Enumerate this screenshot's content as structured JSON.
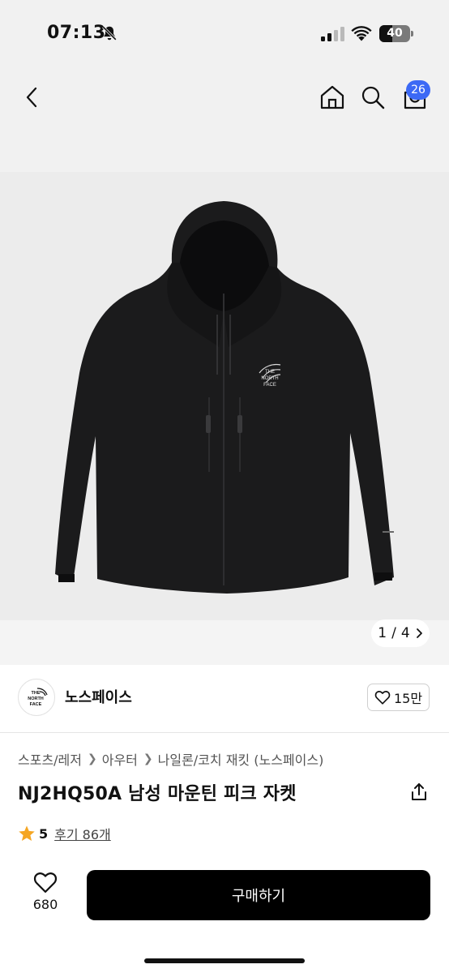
{
  "status_bar": {
    "time": "07:13",
    "battery": "40",
    "icons": [
      "bell-off-icon",
      "signal-icon",
      "wifi-icon",
      "battery-icon"
    ]
  },
  "nav": {
    "icons": [
      "chevron-left-icon",
      "home-icon",
      "search-icon",
      "cart-icon"
    ],
    "cart_badge": "26"
  },
  "product_image": {
    "logo_text": [
      "THE",
      "NORTH",
      "FACE"
    ],
    "counter_current": "1",
    "counter_sep": "/",
    "counter_total": "4",
    "counter_icon": "chevron-right-icon"
  },
  "brand": {
    "name": "노스페이스",
    "logo_text": [
      "THE",
      "NORTH",
      "FACE"
    ],
    "likes": "15만",
    "like_icon": "heart-icon"
  },
  "breadcrumb": [
    "스포츠/레저",
    "아우터",
    "나일론/코치 재킷 (노스페이스)"
  ],
  "product": {
    "title": "NJ2HQ50A 남성 마운틴 피크 자켓",
    "share_icon": "share-icon",
    "rating": "5",
    "review_label": "후기 86개",
    "star_color": "#f5a623"
  },
  "bottom_bar": {
    "wish_count": "680",
    "buy_label": "구매하기"
  }
}
